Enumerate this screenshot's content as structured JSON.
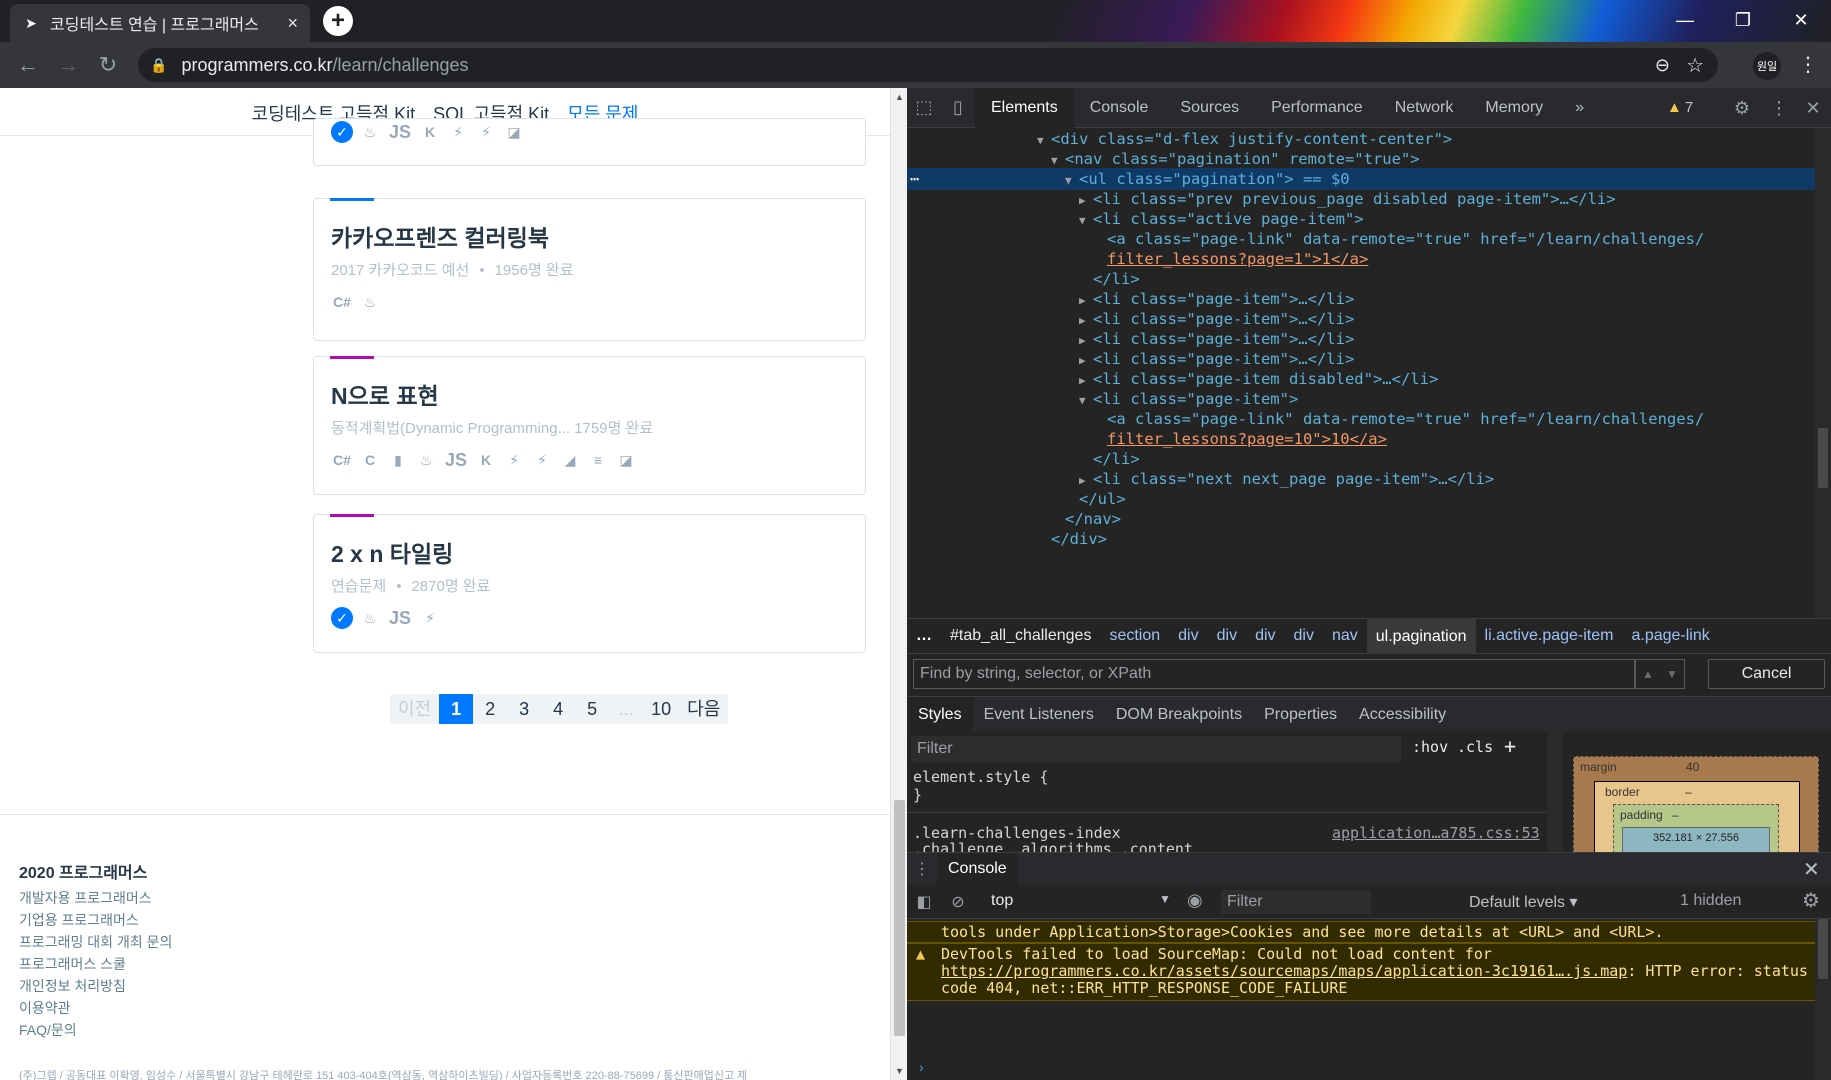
{
  "browser": {
    "tab_title": "코딩테스트 연습 | 프로그래머스",
    "tab_close": "×",
    "new_tab": "+",
    "url_host": "programmers.co.kr",
    "url_path": "/learn/challenges",
    "profile": "원일"
  },
  "page": {
    "nav": [
      "코딩테스트 고득점 Kit",
      "SQL 고득점 Kit",
      "모든 문제"
    ],
    "cards": [
      {
        "title": "카카오프렌즈 컬러링북",
        "meta_left": "2017 카카오코드 예선",
        "meta_right": "1956명 완료",
        "accent": "#0078ff",
        "langs": [
          "C#",
          "♨"
        ]
      },
      {
        "title": "N으로 표현",
        "meta_left": "동적계획법(Dynamic Programming...",
        "meta_right": "1759명 완료",
        "accent": "#b10bb1",
        "langs": [
          "C#",
          "C",
          "▮",
          "♨",
          "JS",
          "K",
          "⚡",
          "⚡",
          "◢",
          "≡",
          "◪"
        ]
      },
      {
        "title": "2 x n 타일링",
        "meta_left": "연습문제",
        "meta_right": "2870명 완료",
        "accent": "#b10bb1",
        "langs": [
          "✓",
          "♨",
          "JS",
          "⚡"
        ]
      }
    ],
    "pagination": {
      "prev": "이전",
      "pages": [
        "1",
        "2",
        "3",
        "4",
        "5",
        "...",
        "10"
      ],
      "next": "다음",
      "active": "1"
    },
    "footer": {
      "heading": "2020 프로그래머스",
      "links": [
        "개발자용 프로그래머스",
        "기업용 프로그래머스",
        "프로그래밍 대회 개최 문의",
        "프로그래머스 스쿨",
        "개인정보 처리방침",
        "이용약관",
        "FAQ/문의"
      ],
      "fine_print": "(주)그렙 / 공동대표 이확영, 임성수 / 서울특별시 강남구 테헤란로 151 403-404호(역삼동, 역삼하이츠빌딩) / 사업자등록번호 220-88-75699 / 통신판매업신고 제"
    }
  },
  "devtools": {
    "tabs": [
      "Elements",
      "Console",
      "Sources",
      "Performance",
      "Network",
      "Memory"
    ],
    "overflow": "»",
    "warnings": "7",
    "dom_lines": [
      "<div class=\"d-flex justify-content-center\">",
      "<nav class=\"pagination\" remote=\"true\">",
      "<ul class=\"pagination\"> == $0",
      "<li class=\"prev previous_page disabled page-item\">…</li>",
      "<li class=\"active page-item\">",
      "<a class=\"page-link\" data-remote=\"true\" href=\"/learn/challenges/",
      "filter_lessons?page=1\">1</a>",
      "</li>",
      "<li class=\"page-item\">…</li>",
      "<li class=\"page-item\">…</li>",
      "<li class=\"page-item\">…</li>",
      "<li class=\"page-item\">…</li>",
      "<li class=\"page-item disabled\">…</li>",
      "<li class=\"page-item\">",
      "<a class=\"page-link\" data-remote=\"true\" href=\"/learn/challenges/",
      "filter_lessons?page=10\">10</a>",
      "</li>",
      "<li class=\"next next_page  page-item\">…</li>",
      "</ul>",
      "</nav>",
      "</div>"
    ],
    "breadcrumbs": [
      "#tab_all_challenges",
      "section",
      "div",
      "div",
      "div",
      "div",
      "nav",
      "ul.pagination",
      "li.active.page-item",
      "a.page-link"
    ],
    "find_placeholder": "Find by string, selector, or XPath",
    "cancel": "Cancel",
    "sub_tabs": [
      "Styles",
      "Event Listeners",
      "DOM Breakpoints",
      "Properties",
      "Accessibility"
    ],
    "styles": {
      "filter_placeholder": "Filter",
      "hov": ":hov",
      "cls": ".cls",
      "element_style": "element.style {",
      "close_brace": "}",
      "selector1": ".learn-challenges-index",
      "selector2": ".challenge__algorithms .content",
      "source": "application…a785.css:53"
    },
    "box_model": {
      "margin_label": "margin",
      "margin_value": "40",
      "border_label": "border",
      "border_value": "–",
      "padding_label": "padding",
      "padding_value": "–",
      "content": "352.181 × 27.556"
    },
    "console": {
      "tab": "Console",
      "context": "top",
      "filter_placeholder": "Filter",
      "levels": "Default levels",
      "hidden": "1 hidden",
      "msg1": "tools under Application>Storage>Cookies and see more details at <URL> and <URL>.",
      "msg2_pre": "DevTools failed to load SourceMap: Could not load content for ",
      "msg2_link": "https://programmers.co.kr/assets/sourcemaps/maps/application-3c19161….js.map",
      "msg2_post": ": HTTP error: status code 404, net::ERR_HTTP_RESPONSE_CODE_FAILURE",
      "prompt": "›"
    }
  }
}
